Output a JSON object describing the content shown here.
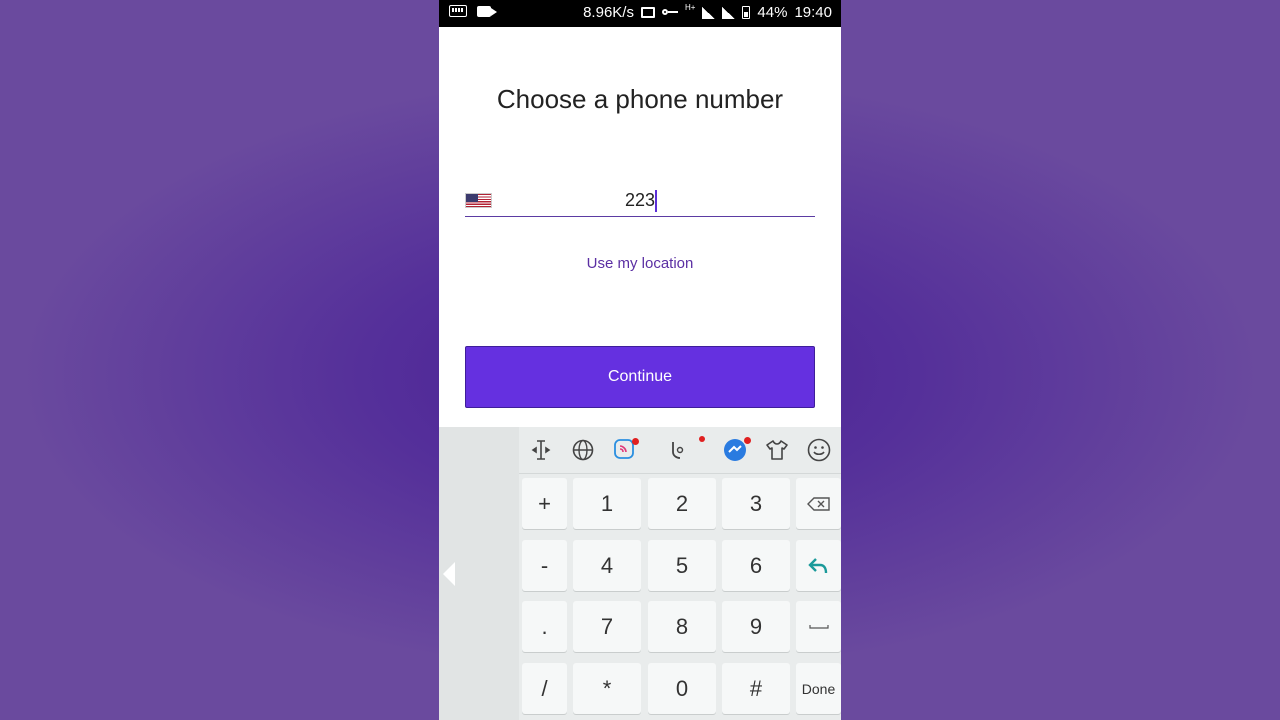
{
  "status_bar": {
    "speed": "8.96K/s",
    "network": "H+",
    "battery": "44%",
    "time": "19:40"
  },
  "screen": {
    "title": "Choose a phone number",
    "country_flag": "us-flag-icon",
    "phone_input": {
      "value": "223"
    },
    "use_location_label": "Use my location",
    "continue_label": "Continue",
    "accent_color": "#6530e0",
    "link_color": "#5b2fa3"
  },
  "keyboard": {
    "toolbar": [
      "cursor-icon",
      "globe-icon",
      "sticker-icon",
      "voice-icon",
      "game-icon",
      "theme-icon",
      "emoji-icon"
    ],
    "rows": [
      [
        "+",
        "1",
        "2",
        "3",
        "backspace"
      ],
      [
        "-",
        "4",
        "5",
        "6",
        "enter"
      ],
      [
        ".",
        "7",
        "8",
        "9",
        "space"
      ],
      [
        "/",
        "*",
        "0",
        "#",
        "Done"
      ]
    ],
    "done_label": "Done"
  }
}
